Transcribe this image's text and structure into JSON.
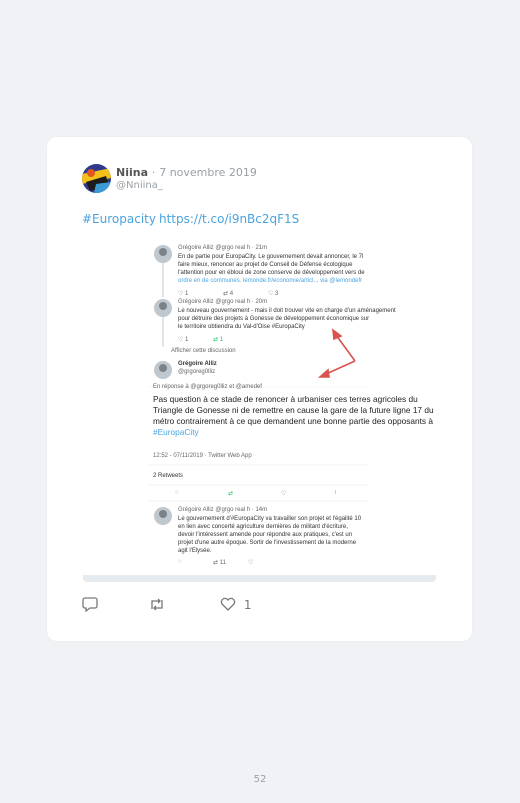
{
  "tweet": {
    "author_name": "Niina",
    "separator": "·",
    "date": "7 novembre 2019",
    "handle": "@Nniina_",
    "text_hashtag": "#Europacity",
    "text_link": "https://t.co/i9nBc2qF1S"
  },
  "embedded": {
    "t1_header": "Grégoire Alliz @grgo real h · 21m",
    "t1_line1": "En de partie pour EuropaCity. Le gouvernement devait annoncer, le 7l",
    "t1_line2": "faire mieux, renoncer au projet de Conseil de Défense écologique",
    "t1_line3": "l'attention pour en ébloui de zone conserve de développement vers de",
    "t1_line4": "ordre en de communes. lemonde.fr/economie/articl... via @lemondefr",
    "t2_header": "Grégoire Alliz @grgo real h · 20m",
    "t2_line1": "Le nouveau gouvernement - mais il doit trouver vite en charge d'un aménagement",
    "t2_line2": "pour détruire des projets à Gonesse de développement économique sur",
    "t2_line3": "le territoire obtiendra du Val-d'Oise #EuropaCity",
    "thread_label": "Afficher cette discussion",
    "main_name": "Grégoire Alliz",
    "main_handle": "@grgoreg0lliz",
    "reply_to": "En réponse à @grgoreg0lliz et @amedef",
    "main_text": "Pas question à ce stade de renoncer à urbaniser ces terres agricoles du Triangle de Gonesse ni de remettre en cause la gare de la future ligne 17 du métro contrairement à ce que demandent une bonne partie des opposants à",
    "main_hashtag": "#EuropaCity",
    "main_time": "12:52 - 07/11/2019 · Twitter Web App",
    "retweets_label": "2 Retweets",
    "t3_header": "Grégoire Alliz @grgo real h · 14m",
    "t3_line1": "Le gouvernement d'#EuropaCity va travailler son projet et l'égalité 10",
    "t3_line2": "en lien avec concerté agriculture dernières de militant d'écriture,",
    "t3_line3": "devoir l'intéressent amende pour répondre aux pratiques, c'est un",
    "t3_line4": "projet d'une autre époque. Sortir de l'investissement de la moderne",
    "t3_line5": "agit l'Elysée.",
    "counts_t1": [
      "1",
      "4",
      "3"
    ],
    "counts_t2": [
      "1",
      "1"
    ],
    "counts_t3": [
      "11"
    ]
  },
  "actions": {
    "like_count": "1"
  },
  "page": {
    "number": "52"
  },
  "colors": {
    "link": "#4aa3df",
    "annotation_arrow": "#d9534f",
    "retweet_green": "#17bf63"
  },
  "icons": [
    "reply-icon",
    "retweet-icon",
    "like-icon",
    "avatar"
  ]
}
